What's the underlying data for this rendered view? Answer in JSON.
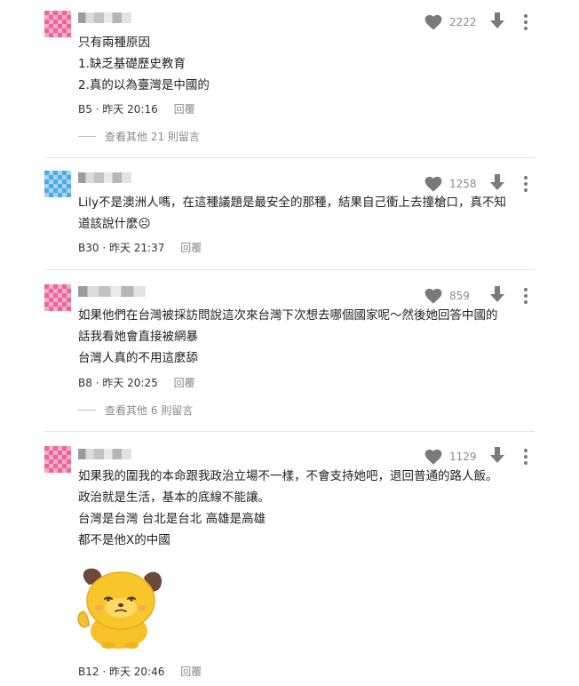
{
  "comments": [
    {
      "likes": "2222",
      "lines": [
        "只有兩種原因",
        "1.缺乏基礎歷史教育",
        "2.真的以為臺灣是中國的"
      ],
      "floor": "B5",
      "time": "昨天 20:16",
      "reply_label": "回覆",
      "more_replies": "查看其他 21 則留言",
      "avatar_color": "#e7689a"
    },
    {
      "likes": "1258",
      "lines": [
        "Lily不是澳洲人嗎，在這種議題是最安全的那種，結果自己衝上去撞槍口，真不知",
        "道該說什麼☹"
      ],
      "floor": "B30",
      "time": "昨天 21:37",
      "reply_label": "回覆",
      "avatar_color": "#4fa9e6"
    },
    {
      "likes": "859",
      "lines": [
        "如果他們在台灣被採訪問說這次來台灣下次想去哪個國家呢～然後她回答中國的",
        "話我看她會直接被網暴",
        "台灣人真的不用這麼舔"
      ],
      "floor": "B8",
      "time": "昨天 20:25",
      "reply_label": "回覆",
      "more_replies": "查看其他 6 則留言",
      "avatar_color": "#e7689a"
    },
    {
      "likes": "1129",
      "lines": [
        "如果我的圍我的本命跟我政治立場不一樣，不會支持她吧，退回普通的路人飯。",
        "政治就是生活，基本的底線不能讓。",
        "台灣是台灣 台北是台北 高雄是高雄",
        "都不是他X的中國"
      ],
      "floor": "B12",
      "time": "昨天 20:46",
      "reply_label": "回覆",
      "sticker": "yellow-dog-sticker",
      "avatar_color": "#e7689a"
    }
  ],
  "meta_separator": " · ",
  "colors": {
    "icon": "#777777",
    "muted_text": "#8a8a8a",
    "divider": "#e5e5e5"
  }
}
